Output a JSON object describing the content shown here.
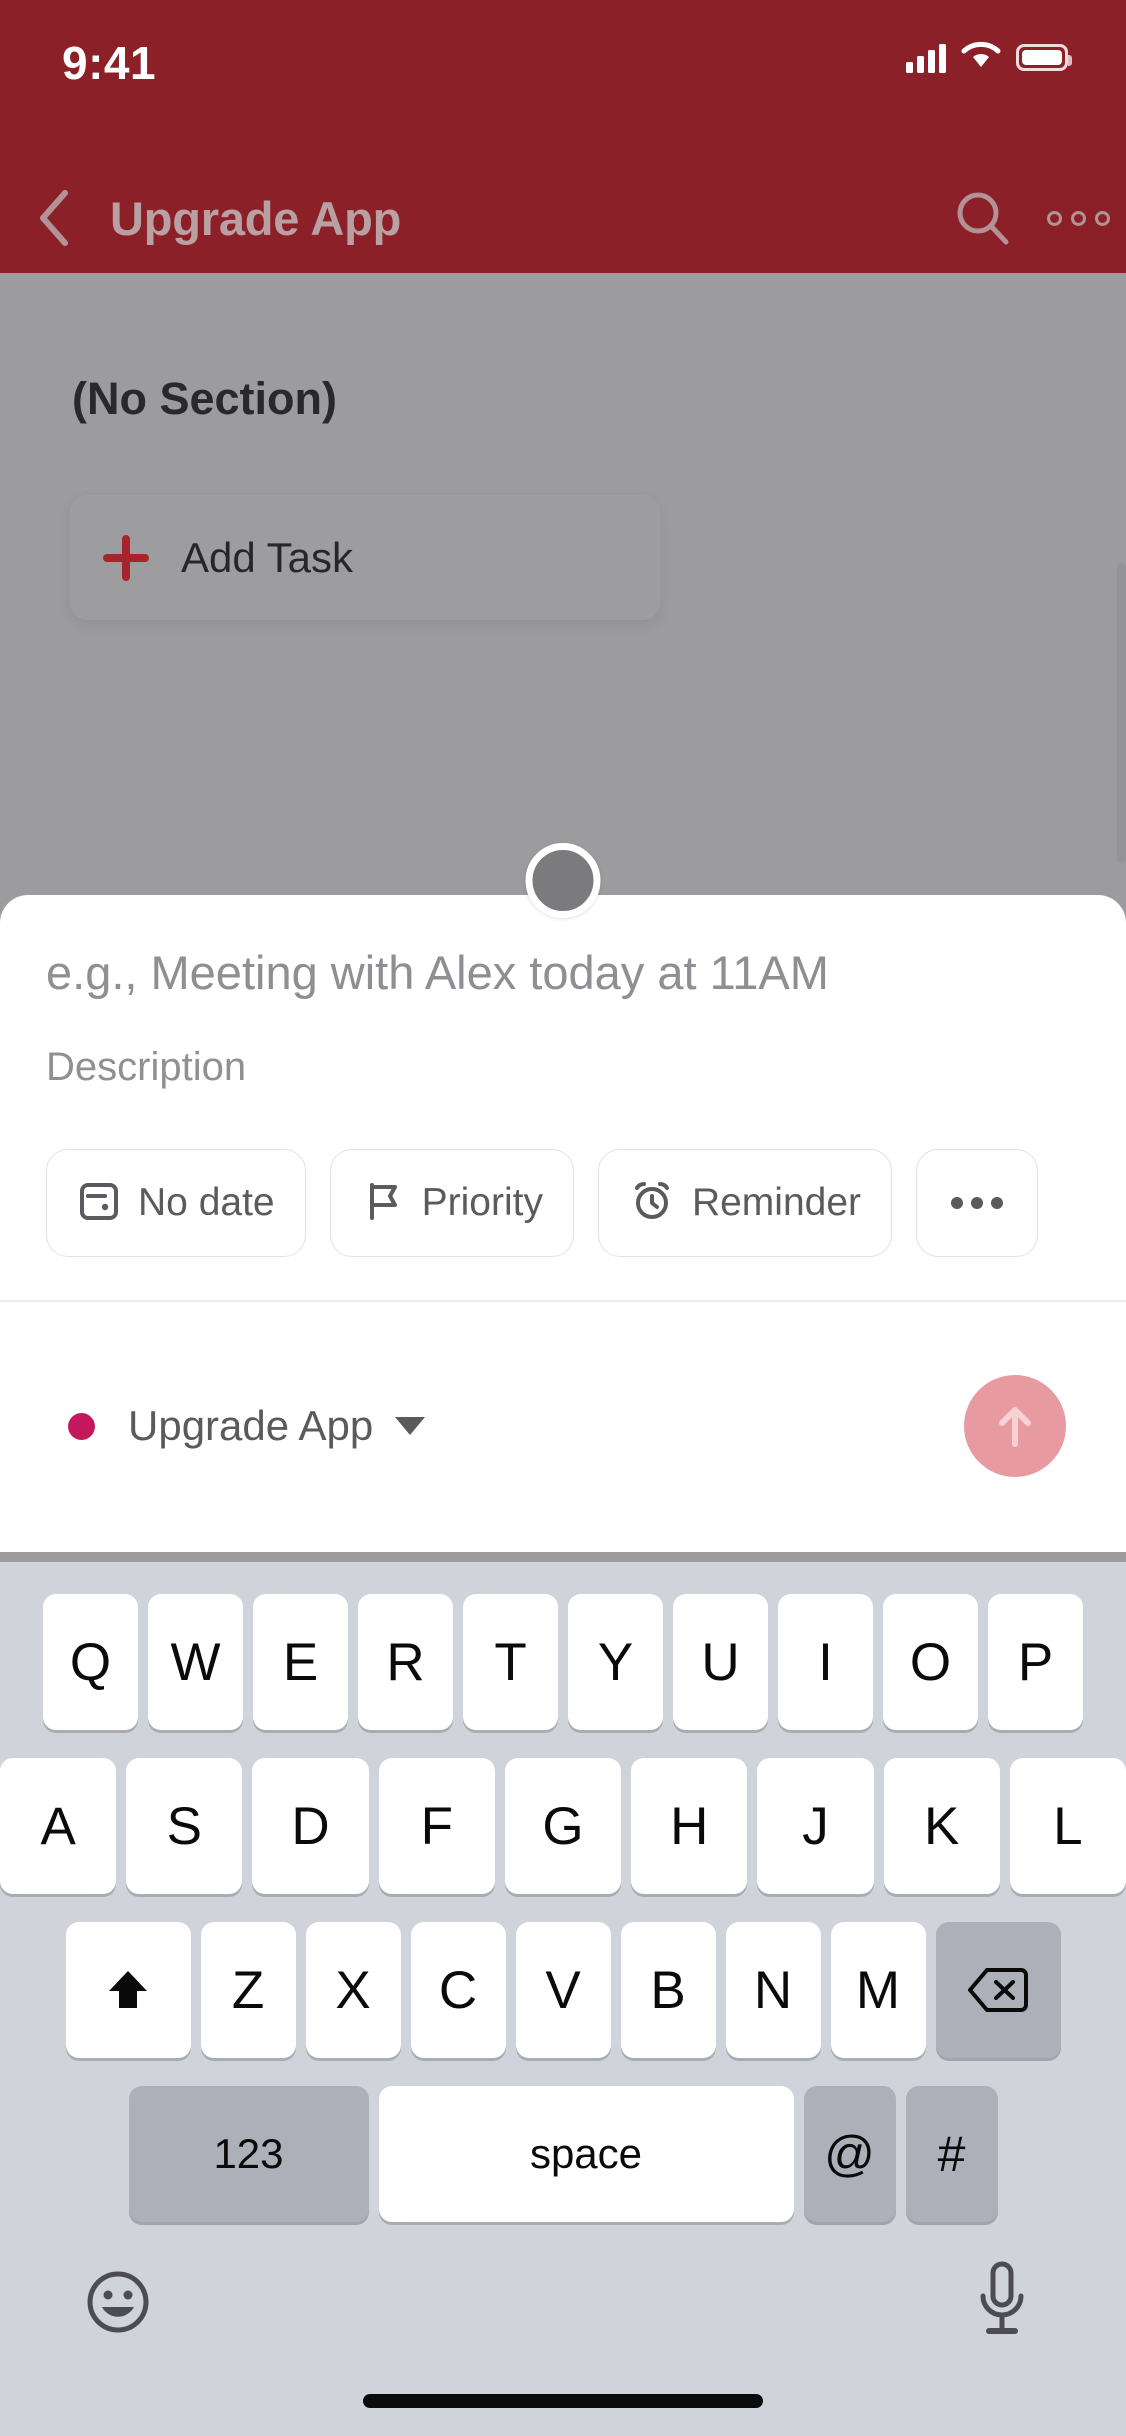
{
  "status_bar": {
    "time": "9:41",
    "signal_icon": "cellular-signal-icon",
    "wifi_icon": "wifi-icon",
    "battery_icon": "battery-icon"
  },
  "nav_bar": {
    "back_icon": "chevron-left-icon",
    "title": "Upgrade App",
    "search_icon": "search-icon",
    "more_icon": "more-options-icon",
    "background_color": "#8C2028",
    "title_color": "#B8A0A3"
  },
  "background_app": {
    "section_title": "(No Section)",
    "add_task_label": "Add Task",
    "add_task_icon": "plus-icon",
    "plus_color": "#A8242C",
    "dim_overlay_color": "#9C9C9E"
  },
  "sheet": {
    "grabber": "drag-handle",
    "title_placeholder": "e.g., Meeting with Alex today at 11AM",
    "description_placeholder": "Description",
    "chips": [
      {
        "label": "No date",
        "icon": "calendar-icon"
      },
      {
        "label": "Priority",
        "icon": "flag-icon"
      },
      {
        "label": "Reminder",
        "icon": "alarm-clock-icon"
      },
      {
        "label": "",
        "icon": "ellipsis-icon"
      }
    ],
    "project": {
      "name": "Upgrade App",
      "dot_color": "#C4185D",
      "caret_icon": "chevron-down-icon"
    },
    "submit": {
      "icon": "arrow-up-icon",
      "color": "#E79AA0",
      "enabled": false
    }
  },
  "keyboard": {
    "row1": [
      "Q",
      "W",
      "E",
      "R",
      "T",
      "Y",
      "U",
      "I",
      "O",
      "P"
    ],
    "row2": [
      "A",
      "S",
      "D",
      "F",
      "G",
      "H",
      "J",
      "K",
      "L"
    ],
    "row3_letters": [
      "Z",
      "X",
      "C",
      "V",
      "B",
      "N",
      "M"
    ],
    "shift_icon": "shift-icon",
    "backspace_icon": "backspace-icon",
    "row4": {
      "numbers_label": "123",
      "space_label": "space",
      "at_label": "@",
      "hash_label": "#"
    },
    "emoji_icon": "emoji-icon",
    "mic_icon": "microphone-icon",
    "background_color": "#D1D3DA"
  },
  "home_indicator": "home-indicator"
}
